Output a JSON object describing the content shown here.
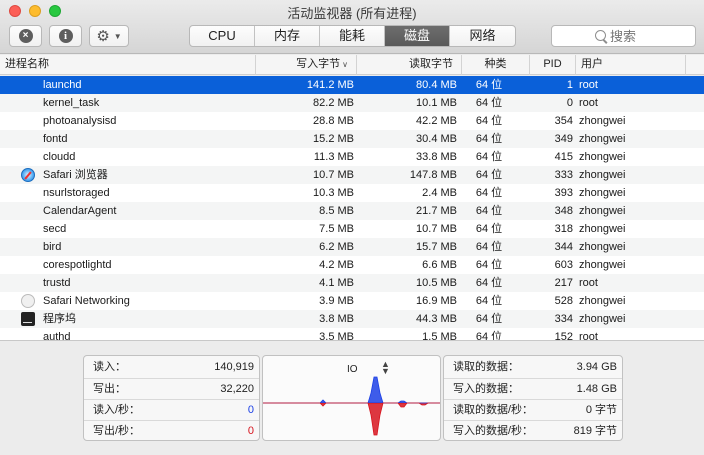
{
  "window": {
    "title": "活动监视器 (所有进程)"
  },
  "toolbar": {
    "tabs": [
      {
        "label": "CPU",
        "active": false
      },
      {
        "label": "内存",
        "active": false
      },
      {
        "label": "能耗",
        "active": false
      },
      {
        "label": "磁盘",
        "active": true
      },
      {
        "label": "网络",
        "active": false
      }
    ],
    "search_placeholder": "搜索"
  },
  "table": {
    "columns": {
      "name": "进程名称",
      "write": "写入字节",
      "read": "读取字节",
      "kind": "种类",
      "pid": "PID",
      "user": "用户"
    },
    "rows": [
      {
        "name": "launchd",
        "write": "141.2 MB",
        "read": "80.4 MB",
        "kind": "64 位",
        "pid": "1",
        "user": "root",
        "icon": ""
      },
      {
        "name": "kernel_task",
        "write": "82.2 MB",
        "read": "10.1 MB",
        "kind": "64 位",
        "pid": "0",
        "user": "root",
        "icon": ""
      },
      {
        "name": "photoanalysisd",
        "write": "28.8 MB",
        "read": "42.2 MB",
        "kind": "64 位",
        "pid": "354",
        "user": "zhongwei",
        "icon": ""
      },
      {
        "name": "fontd",
        "write": "15.2 MB",
        "read": "30.4 MB",
        "kind": "64 位",
        "pid": "349",
        "user": "zhongwei",
        "icon": ""
      },
      {
        "name": "cloudd",
        "write": "11.3 MB",
        "read": "33.8 MB",
        "kind": "64 位",
        "pid": "415",
        "user": "zhongwei",
        "icon": ""
      },
      {
        "name": "Safari 浏览器",
        "write": "10.7 MB",
        "read": "147.8 MB",
        "kind": "64 位",
        "pid": "333",
        "user": "zhongwei",
        "icon": "safari"
      },
      {
        "name": "nsurlstoraged",
        "write": "10.3 MB",
        "read": "2.4 MB",
        "kind": "64 位",
        "pid": "393",
        "user": "zhongwei",
        "icon": ""
      },
      {
        "name": "CalendarAgent",
        "write": "8.5 MB",
        "read": "21.7 MB",
        "kind": "64 位",
        "pid": "348",
        "user": "zhongwei",
        "icon": ""
      },
      {
        "name": "secd",
        "write": "7.5 MB",
        "read": "10.7 MB",
        "kind": "64 位",
        "pid": "318",
        "user": "zhongwei",
        "icon": ""
      },
      {
        "name": "bird",
        "write": "6.2 MB",
        "read": "15.7 MB",
        "kind": "64 位",
        "pid": "344",
        "user": "zhongwei",
        "icon": ""
      },
      {
        "name": "corespotlightd",
        "write": "4.2 MB",
        "read": "6.6 MB",
        "kind": "64 位",
        "pid": "603",
        "user": "zhongwei",
        "icon": ""
      },
      {
        "name": "trustd",
        "write": "4.1 MB",
        "read": "10.5 MB",
        "kind": "64 位",
        "pid": "217",
        "user": "root",
        "icon": ""
      },
      {
        "name": "Safari Networking",
        "write": "3.9 MB",
        "read": "16.9 MB",
        "kind": "64 位",
        "pid": "528",
        "user": "zhongwei",
        "icon": "globe"
      },
      {
        "name": "程序坞",
        "write": "3.8 MB",
        "read": "44.3 MB",
        "kind": "64 位",
        "pid": "334",
        "user": "zhongwei",
        "icon": "terminal"
      },
      {
        "name": "authd",
        "write": "3.5 MB",
        "read": "1.5 MB",
        "kind": "64 位",
        "pid": "152",
        "user": "root",
        "icon": ""
      }
    ]
  },
  "stats_left": [
    {
      "label": "读入：",
      "value": "140,919",
      "color": ""
    },
    {
      "label": "写出：",
      "value": "32,220",
      "color": ""
    },
    {
      "label": "读入/秒：",
      "value": "0",
      "color": "blue"
    },
    {
      "label": "写出/秒：",
      "value": "0",
      "color": "red"
    }
  ],
  "graph": {
    "title": "IO",
    "read_color": "#1c40e6",
    "write_color": "#d7141e"
  },
  "stats_right": [
    {
      "label": "读取的数据：",
      "value": "3.94 GB"
    },
    {
      "label": "写入的数据：",
      "value": "1.48 GB"
    },
    {
      "label": "读取的数据/秒：",
      "value": "0 字节"
    },
    {
      "label": "写入的数据/秒：",
      "value": "819 字节"
    }
  ]
}
